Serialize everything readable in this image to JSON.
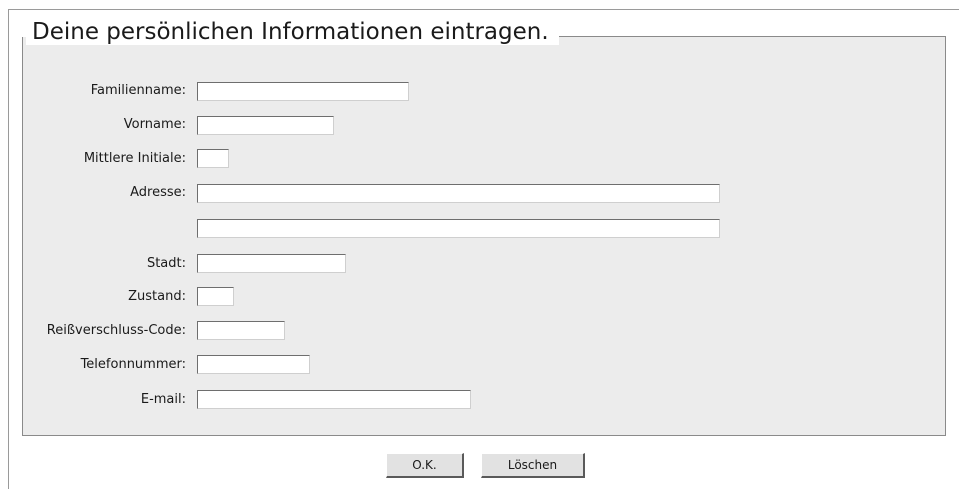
{
  "form": {
    "legend": "Deine persönlichen Informationen eintragen.",
    "fields": {
      "last_name": {
        "label": "Familienname:",
        "value": ""
      },
      "first_name": {
        "label": "Vorname:",
        "value": ""
      },
      "middle_initial": {
        "label": "Mittlere Initiale:",
        "value": ""
      },
      "address": {
        "label": "Adresse:",
        "value": "",
        "value2": ""
      },
      "city": {
        "label": "Stadt:",
        "value": ""
      },
      "state": {
        "label": "Zustand:",
        "value": ""
      },
      "zip": {
        "label": "Reißverschluss-Code:",
        "value": ""
      },
      "phone": {
        "label": "Telefonnummer:",
        "value": ""
      },
      "email": {
        "label": "E-mail:",
        "value": ""
      }
    }
  },
  "buttons": {
    "ok_label": "O.K.",
    "clear_label": "Löschen"
  }
}
